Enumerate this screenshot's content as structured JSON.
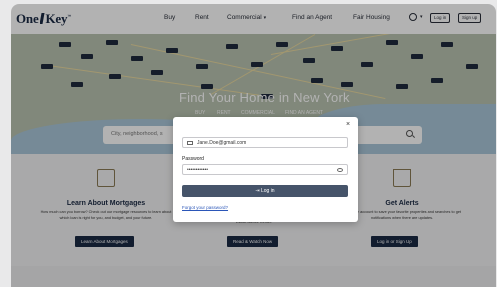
{
  "header": {
    "logo_text_a": "One",
    "logo_text_b": "Key",
    "logo_tm": "™",
    "nav": [
      "Buy",
      "Rent",
      "Commercial",
      "Find an Agent",
      "Fair Housing"
    ],
    "commercial_caret": "▾",
    "login_label": "Log in",
    "signup_label": "Sign up"
  },
  "hero": {
    "title": "Find Your Home in New York",
    "tabs": [
      "BUY",
      "RENT",
      "COMMERCIAL",
      "FIND AN AGENT"
    ],
    "search_placeholder": "City, neighborhood, s"
  },
  "cards": [
    {
      "title": "Learn About Mortgages",
      "text": "How much can you borrow? Check out our mortgage resources to learn about which loan is right for you, and budget, and your future.",
      "button": "Learn About Mortgages"
    },
    {
      "title": "",
      "text": "Estate Advice Center.",
      "button": "Read & Watch Now"
    },
    {
      "title": "Get Alerts",
      "text": "ate a free account to save your favorite properties and searches to get notifications when there are updates.",
      "button": "Log in or Sign Up"
    }
  ],
  "modal": {
    "close": "×",
    "email_value": "Jane.Doe@gmail.com",
    "password_label": "Password",
    "password_value": "••••••••••••",
    "login_button": "⇥ Log in",
    "forgot_link": "Forgot your password?"
  }
}
